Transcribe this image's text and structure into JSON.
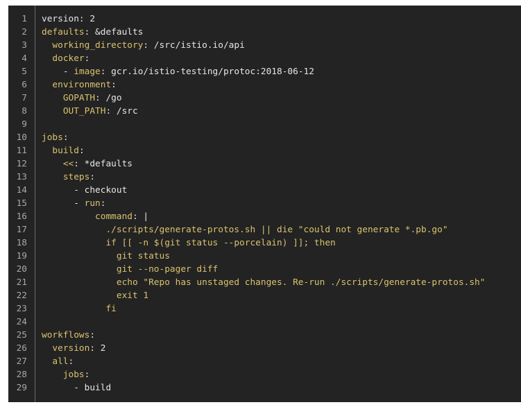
{
  "colors": {
    "background": "#232323",
    "line_number": "#a8a8a8",
    "text": "#e6e6e6",
    "key": "#d9c36e"
  },
  "lines": [
    {
      "n": "1",
      "tokens": [
        {
          "t": "version: 2",
          "c": "text"
        }
      ]
    },
    {
      "n": "2",
      "tokens": [
        {
          "t": "defaults",
          "c": "key"
        },
        {
          "t": ": &defaults",
          "c": "text"
        }
      ]
    },
    {
      "n": "3",
      "tokens": [
        {
          "t": "  working_directory",
          "c": "key"
        },
        {
          "t": ": /src/istio.io/api",
          "c": "text"
        }
      ]
    },
    {
      "n": "4",
      "tokens": [
        {
          "t": "  docker",
          "c": "key"
        },
        {
          "t": ":",
          "c": "text"
        }
      ]
    },
    {
      "n": "5",
      "tokens": [
        {
          "t": "    - ",
          "c": "text"
        },
        {
          "t": "image",
          "c": "key"
        },
        {
          "t": ": gcr.io/istio-testing/protoc:2018-06-12",
          "c": "text"
        }
      ]
    },
    {
      "n": "6",
      "tokens": [
        {
          "t": "  environment",
          "c": "key"
        },
        {
          "t": ":",
          "c": "text"
        }
      ]
    },
    {
      "n": "7",
      "tokens": [
        {
          "t": "    GOPATH",
          "c": "key"
        },
        {
          "t": ": /go",
          "c": "text"
        }
      ]
    },
    {
      "n": "8",
      "tokens": [
        {
          "t": "    OUT_PATH",
          "c": "key"
        },
        {
          "t": ": /src",
          "c": "text"
        }
      ]
    },
    {
      "n": "9",
      "tokens": []
    },
    {
      "n": "10",
      "tokens": [
        {
          "t": "jobs",
          "c": "key"
        },
        {
          "t": ":",
          "c": "text"
        }
      ]
    },
    {
      "n": "11",
      "tokens": [
        {
          "t": "  build",
          "c": "key"
        },
        {
          "t": ":",
          "c": "text"
        }
      ]
    },
    {
      "n": "12",
      "tokens": [
        {
          "t": "    <<",
          "c": "key"
        },
        {
          "t": ": *defaults",
          "c": "text"
        }
      ]
    },
    {
      "n": "13",
      "tokens": [
        {
          "t": "    steps",
          "c": "key"
        },
        {
          "t": ":",
          "c": "text"
        }
      ]
    },
    {
      "n": "14",
      "tokens": [
        {
          "t": "      - checkout",
          "c": "text"
        }
      ]
    },
    {
      "n": "15",
      "tokens": [
        {
          "t": "      - ",
          "c": "text"
        },
        {
          "t": "run",
          "c": "key"
        },
        {
          "t": ":",
          "c": "text"
        }
      ]
    },
    {
      "n": "16",
      "tokens": [
        {
          "t": "          command",
          "c": "key"
        },
        {
          "t": ": |",
          "c": "text"
        }
      ]
    },
    {
      "n": "17",
      "tokens": [
        {
          "t": "            ./scripts/generate-protos.sh || die \"could not generate *.pb.go\"",
          "c": "key"
        }
      ]
    },
    {
      "n": "18",
      "tokens": [
        {
          "t": "            if [[ -n $(git status --porcelain) ]]; then",
          "c": "key"
        }
      ]
    },
    {
      "n": "19",
      "tokens": [
        {
          "t": "              git status",
          "c": "key"
        }
      ]
    },
    {
      "n": "20",
      "tokens": [
        {
          "t": "              git --no-pager diff",
          "c": "key"
        }
      ]
    },
    {
      "n": "21",
      "tokens": [
        {
          "t": "              echo \"Repo has unstaged changes. Re-run ./scripts/generate-protos.sh\"",
          "c": "key"
        }
      ]
    },
    {
      "n": "22",
      "tokens": [
        {
          "t": "              exit 1",
          "c": "key"
        }
      ]
    },
    {
      "n": "23",
      "tokens": [
        {
          "t": "            fi",
          "c": "key"
        }
      ]
    },
    {
      "n": "24",
      "tokens": []
    },
    {
      "n": "25",
      "tokens": [
        {
          "t": "workflows",
          "c": "key"
        },
        {
          "t": ":",
          "c": "text"
        }
      ]
    },
    {
      "n": "26",
      "tokens": [
        {
          "t": "  version",
          "c": "key"
        },
        {
          "t": ": 2",
          "c": "text"
        }
      ]
    },
    {
      "n": "27",
      "tokens": [
        {
          "t": "  all",
          "c": "key"
        },
        {
          "t": ":",
          "c": "text"
        }
      ]
    },
    {
      "n": "28",
      "tokens": [
        {
          "t": "    jobs",
          "c": "key"
        },
        {
          "t": ":",
          "c": "text"
        }
      ]
    },
    {
      "n": "29",
      "tokens": [
        {
          "t": "      - build",
          "c": "text"
        }
      ]
    }
  ]
}
